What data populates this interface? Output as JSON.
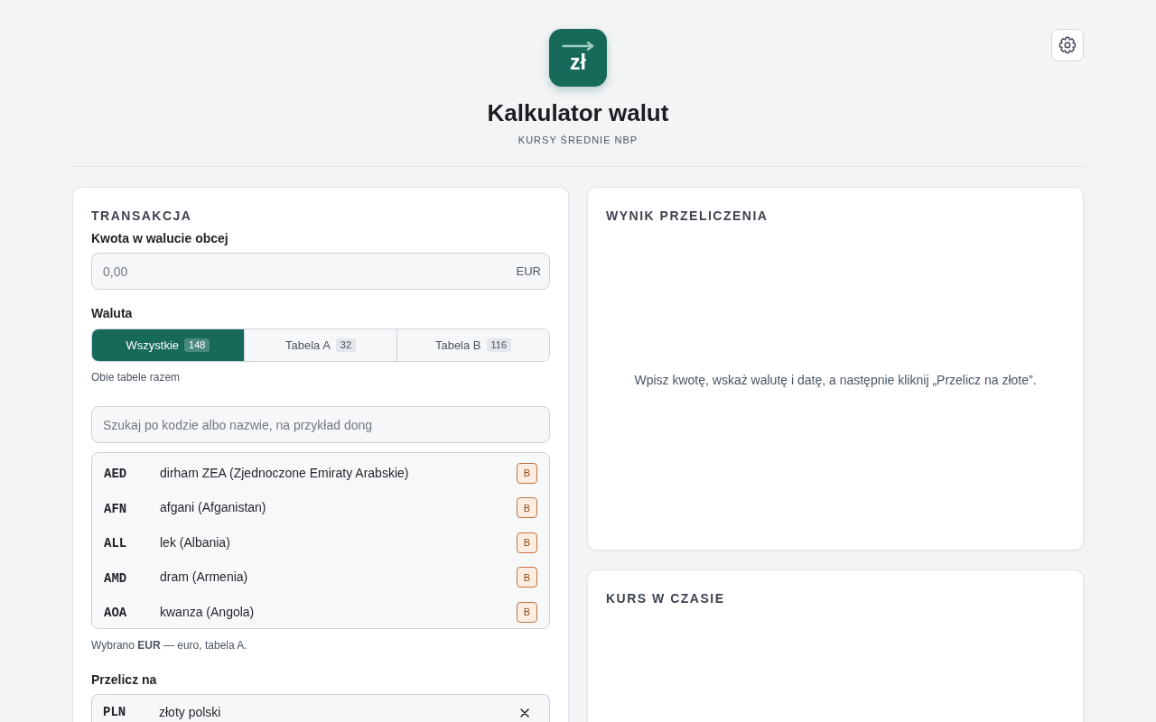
{
  "header": {
    "logo_text": "zł",
    "title": "Kalkulator walut",
    "subtitle": "KURSY ŚREDNIE NBP"
  },
  "transaction": {
    "heading": "TRANSAKCJA",
    "amount": {
      "label": "Kwota w walucie obcej",
      "placeholder": "0,00",
      "suffix": "EUR"
    },
    "currency": {
      "label": "Waluta",
      "tabs": [
        {
          "label": "Wszystkie",
          "count": "148",
          "selected": true
        },
        {
          "label": "Tabela A",
          "count": "32",
          "selected": false
        },
        {
          "label": "Tabela B",
          "count": "116",
          "selected": false
        }
      ],
      "hint": "Obie tabele razem",
      "search": {
        "placeholder": "Szukaj po kodzie albo nazwie, na przykład dong"
      },
      "list": [
        {
          "code": "AED",
          "name": "dirham ZEA (Zjednoczone Emiraty Arabskie)",
          "table": "B"
        },
        {
          "code": "AFN",
          "name": "afgani (Afganistan)",
          "table": "B"
        },
        {
          "code": "ALL",
          "name": "lek (Albania)",
          "table": "B"
        },
        {
          "code": "AMD",
          "name": "dram (Armenia)",
          "table": "B"
        },
        {
          "code": "AOA",
          "name": "kwanza (Angola)",
          "table": "B"
        }
      ],
      "selection_note": "Wybrano **EUR** — euro, tabela A."
    },
    "target": {
      "label": "Przelicz na",
      "code": "PLN",
      "name": "złoty polski"
    }
  },
  "result": {
    "heading": "WYNIK PRZELICZENIA",
    "message": "Wpisz kwotę, wskaż walutę i datę, a następnie kliknij „Przelicz na złote”."
  },
  "history": {
    "heading": "KURS W CZASIE"
  }
}
